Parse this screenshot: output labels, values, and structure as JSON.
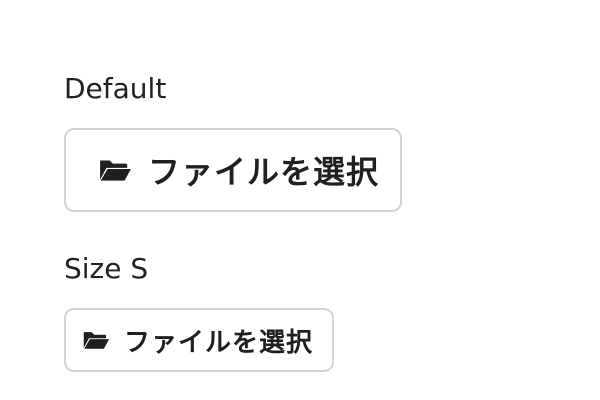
{
  "sections": [
    {
      "label": "Default",
      "button": {
        "label": "ファイルを選択",
        "icon": "folder-open-icon"
      }
    },
    {
      "label": "Size S",
      "button": {
        "label": "ファイルを選択",
        "icon": "folder-open-icon"
      }
    }
  ],
  "colors": {
    "text": "#222222",
    "border": "#d3d3d3",
    "background": "#ffffff"
  }
}
